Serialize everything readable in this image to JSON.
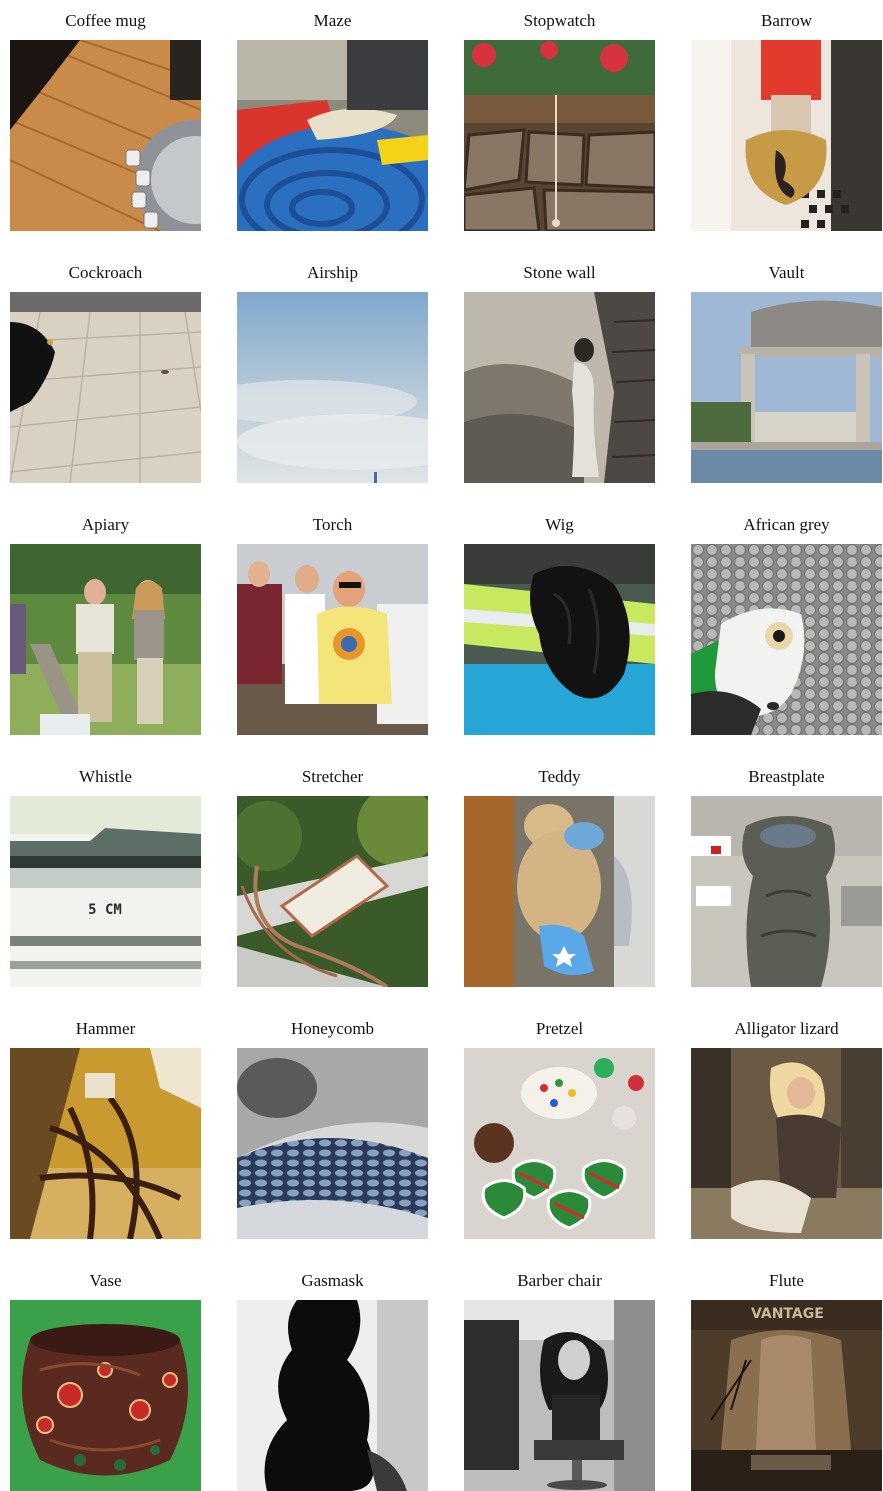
{
  "grid": {
    "rows": [
      [
        {
          "label": "Coffee mug"
        },
        {
          "label": "Maze"
        },
        {
          "label": "Stopwatch"
        },
        {
          "label": "Barrow"
        }
      ],
      [
        {
          "label": "Cockroach"
        },
        {
          "label": "Airship"
        },
        {
          "label": "Stone wall"
        },
        {
          "label": "Vault"
        }
      ],
      [
        {
          "label": "Apiary"
        },
        {
          "label": "Torch"
        },
        {
          "label": "Wig"
        },
        {
          "label": "African grey"
        }
      ],
      [
        {
          "label": "Whistle"
        },
        {
          "label": "Stretcher"
        },
        {
          "label": "Teddy"
        },
        {
          "label": "Breastplate"
        }
      ],
      [
        {
          "label": "Hammer"
        },
        {
          "label": "Honeycomb"
        },
        {
          "label": "Pretzel"
        },
        {
          "label": "Alligator lizard"
        }
      ],
      [
        {
          "label": "Vase"
        },
        {
          "label": "Gasmask"
        },
        {
          "label": "Barber chair"
        },
        {
          "label": "Flute"
        }
      ]
    ]
  },
  "photo_texts": {
    "ruler_mark": "5 CM",
    "flute_sign": "VANTAGE"
  }
}
